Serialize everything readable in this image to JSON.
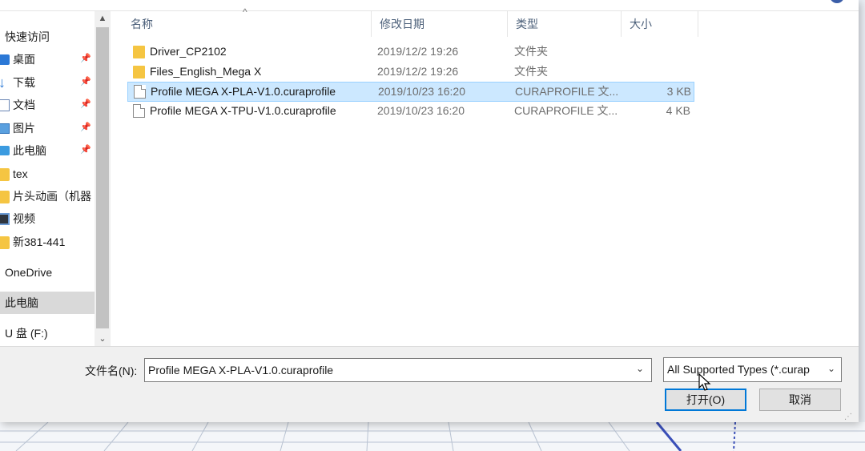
{
  "nav": {
    "items": [
      {
        "label": "快速访问",
        "icon": "star-icon",
        "pinned": false,
        "selected": false
      },
      {
        "label": "桌面",
        "icon": "desktop-icon",
        "pinned": true,
        "selected": false
      },
      {
        "label": "下载",
        "icon": "download-icon",
        "pinned": true,
        "selected": false
      },
      {
        "label": "文档",
        "icon": "document-icon",
        "pinned": true,
        "selected": false
      },
      {
        "label": "图片",
        "icon": "picture-icon",
        "pinned": true,
        "selected": false
      },
      {
        "label": "此电脑",
        "icon": "computer-icon",
        "pinned": true,
        "selected": false
      },
      {
        "label": "tex",
        "icon": "folder-icon",
        "pinned": false,
        "selected": false
      },
      {
        "label": "片头动画（机器",
        "icon": "folder-icon",
        "pinned": false,
        "selected": false
      },
      {
        "label": "视频",
        "icon": "video-icon",
        "pinned": false,
        "selected": false
      },
      {
        "label": "新381-441",
        "icon": "folder-icon",
        "pinned": false,
        "selected": false
      },
      {
        "label": "OneDrive",
        "icon": "cloud-icon",
        "pinned": false,
        "selected": false
      },
      {
        "label": "此电脑",
        "icon": "computer-icon",
        "pinned": false,
        "selected": true
      },
      {
        "label": "U 盘 (F:)",
        "icon": "usb-drive-icon",
        "pinned": false,
        "selected": false
      }
    ],
    "pin_glyph": "📌",
    "scroll_up": "▲",
    "scroll_down": "⌄"
  },
  "columns": {
    "name": "名称",
    "date": "修改日期",
    "type": "类型",
    "size": "大小"
  },
  "files": [
    {
      "name": "Driver_CP2102",
      "date": "2019/12/2 19:26",
      "type": "文件夹",
      "size": "",
      "kind": "folder",
      "selected": false
    },
    {
      "name": "Files_English_Mega X",
      "date": "2019/12/2 19:26",
      "type": "文件夹",
      "size": "",
      "kind": "folder",
      "selected": false
    },
    {
      "name": "Profile MEGA X-PLA-V1.0.curaprofile",
      "date": "2019/10/23 16:20",
      "type": "CURAPROFILE 文...",
      "size": "3 KB",
      "kind": "file",
      "selected": true
    },
    {
      "name": "Profile MEGA X-TPU-V1.0.curaprofile",
      "date": "2019/10/23 16:20",
      "type": "CURAPROFILE 文...",
      "size": "4 KB",
      "kind": "file",
      "selected": false
    }
  ],
  "bottom": {
    "filename_label": "文件名(N):",
    "filename_value": "Profile MEGA X-PLA-V1.0.curaprofile",
    "filetype_value": "All Supported Types (*.curap",
    "open_label": "打开(O)",
    "cancel_label": "取消"
  },
  "colors": {
    "selection": "#cce8ff",
    "accent": "#0078d7",
    "folder": "#f5c542"
  }
}
